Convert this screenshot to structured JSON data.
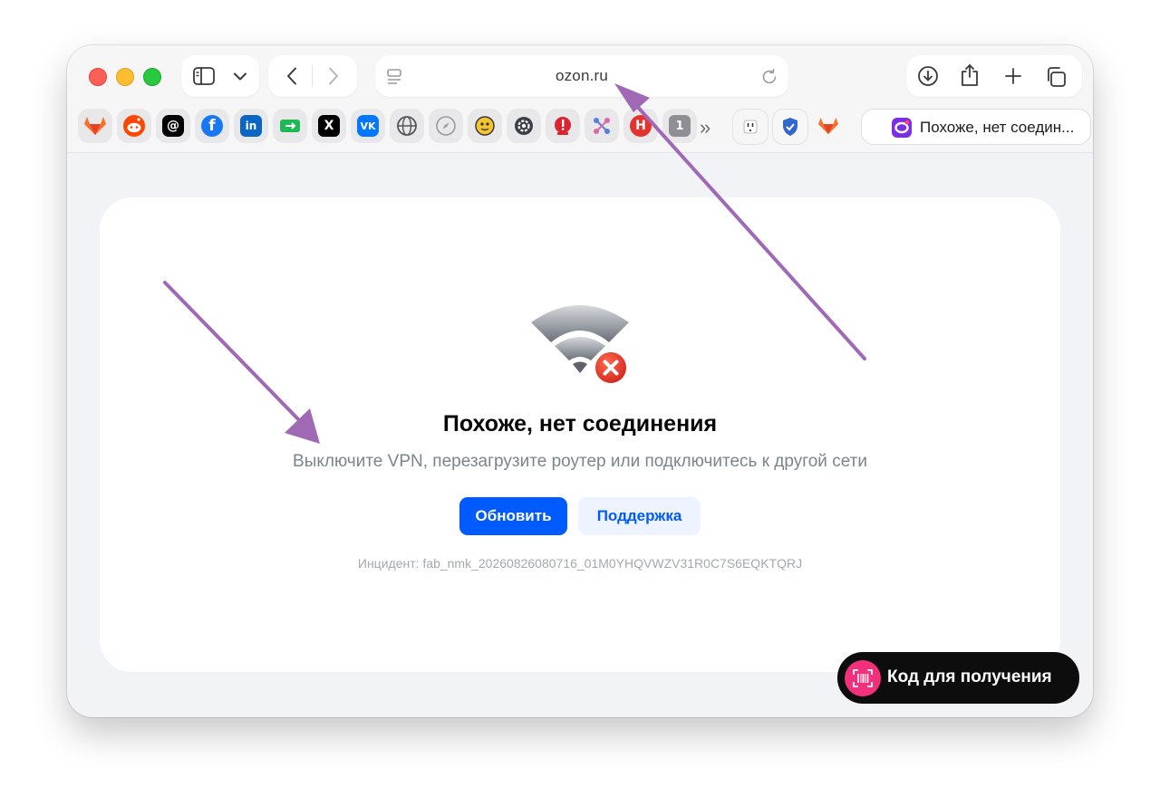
{
  "browser": {
    "url": "ozon.ru",
    "active_tab_title": "Похоже, нет соедин...",
    "favorites_overflow_glyph": "»",
    "favorites": [
      {
        "name": "gitlab",
        "glyph": "",
        "color": "#fc6d26"
      },
      {
        "name": "reddit",
        "glyph": "",
        "color": "#ff4500"
      },
      {
        "name": "threads",
        "glyph": "@",
        "color": "#000000"
      },
      {
        "name": "facebook",
        "glyph": "f",
        "color": "#1877f2"
      },
      {
        "name": "linkedin",
        "glyph": "in",
        "color": "#0a66c2"
      },
      {
        "name": "green-app",
        "glyph": "",
        "color": "#1db954"
      },
      {
        "name": "x",
        "glyph": "X",
        "color": "#000000"
      },
      {
        "name": "vk",
        "glyph": "VK",
        "color": "#0077ff"
      },
      {
        "name": "globe-app",
        "glyph": "",
        "color": "#555555"
      },
      {
        "name": "compass-app",
        "glyph": "",
        "color": "#9a9a9a"
      },
      {
        "name": "emoji-app",
        "glyph": "",
        "color": "#f4c430"
      },
      {
        "name": "settings-app",
        "glyph": "",
        "color": "#3a3f4a"
      },
      {
        "name": "red-app",
        "glyph": "",
        "color": "#d9252f"
      },
      {
        "name": "network-app",
        "glyph": "",
        "color": "#5b7dd8"
      },
      {
        "name": "habr",
        "glyph": "H",
        "color": "#e4332e"
      },
      {
        "name": "tab-group-badge",
        "glyph": "1",
        "color": "#8e8e93"
      }
    ],
    "pinned_tabs": [
      {
        "name": "plug-app",
        "glyph": "",
        "color": "#444444"
      },
      {
        "name": "shield-app",
        "glyph": "",
        "color": "#3366cc"
      },
      {
        "name": "gitlab-pinned",
        "glyph": "",
        "color": "#fc6d26"
      }
    ]
  },
  "page": {
    "heading": "Похоже, нет соединения",
    "subtext": "Выключите VPN, перезагрузите роутер или подключитесь к другой сети",
    "refresh_button": "Обновить",
    "support_button": "Поддержка",
    "incident": "Инцидент: fab_nmk_20260826080716_01M0YHQVWZV31R0C7S6EQKTQRJ",
    "barcode_button": "Код для получения"
  },
  "colors": {
    "primary": "#005bff",
    "secondary_bg": "#eef4ff",
    "annotation_arrow": "#a069b5",
    "error_badge": "#e8402e",
    "barcode_accent": "#f2307b"
  }
}
